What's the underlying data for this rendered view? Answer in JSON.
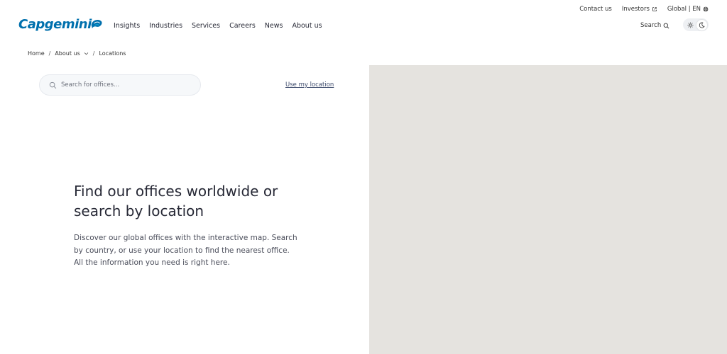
{
  "logo": {
    "text": "Capgemini"
  },
  "utility_nav": {
    "contact": "Contact us",
    "investors": "Investors",
    "global": "Global | EN"
  },
  "main_nav": {
    "items": [
      "Insights",
      "Industries",
      "Services",
      "Careers",
      "News",
      "About us"
    ]
  },
  "header": {
    "search_label": "Search"
  },
  "breadcrumb": {
    "home": "Home",
    "about": "About us",
    "current": "Locations"
  },
  "office_search": {
    "placeholder": "Search for offices...",
    "use_location": "Use my location"
  },
  "hero": {
    "title": "Find our offices worldwide or search by location",
    "description": "Discover our global offices with the interactive map. Search by country, or use your location to find the nearest office. All the information you need is right here."
  },
  "colors": {
    "brand": "#0070ad",
    "map_background": "#e5e3df"
  }
}
